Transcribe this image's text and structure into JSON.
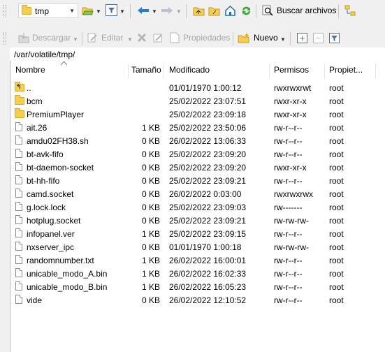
{
  "toolbar_top": {
    "location_value": "tmp",
    "search_label": "Buscar archivos"
  },
  "toolbar_actions": {
    "download_label": "Descargar",
    "edit_label": "Editar",
    "properties_label": "Propiedades",
    "new_label": "Nuevo"
  },
  "path": "/var/volatile/tmp/",
  "columns": {
    "name": "Nombre",
    "size": "Tamaño",
    "modified": "Modificado",
    "permissions": "Permisos",
    "owner": "Propiet..."
  },
  "files": [
    {
      "name": "..",
      "size": "",
      "modified": "01/01/1970 1:00:12",
      "permissions": "rwxrwxrwt",
      "owner": "root",
      "type": "parent"
    },
    {
      "name": "bcm",
      "size": "",
      "modified": "25/02/2022 23:07:51",
      "permissions": "rwxr-xr-x",
      "owner": "root",
      "type": "folder"
    },
    {
      "name": "PremiumPlayer",
      "size": "",
      "modified": "25/02/2022 23:09:18",
      "permissions": "rwxr-xr-x",
      "owner": "root",
      "type": "folder"
    },
    {
      "name": "ait.26",
      "size": "1 KB",
      "modified": "25/02/2022 23:50:06",
      "permissions": "rw-r--r--",
      "owner": "root",
      "type": "file"
    },
    {
      "name": "amdu02FH38.sh",
      "size": "0 KB",
      "modified": "26/02/2022 13:06:33",
      "permissions": "rw-r--r--",
      "owner": "root",
      "type": "file"
    },
    {
      "name": "bt-avk-fifo",
      "size": "0 KB",
      "modified": "25/02/2022 23:09:20",
      "permissions": "rw-r--r--",
      "owner": "root",
      "type": "file"
    },
    {
      "name": "bt-daemon-socket",
      "size": "0 KB",
      "modified": "25/02/2022 23:09:20",
      "permissions": "rwxr-xr-x",
      "owner": "root",
      "type": "file"
    },
    {
      "name": "bt-hh-fifo",
      "size": "0 KB",
      "modified": "25/02/2022 23:09:21",
      "permissions": "rw-r--r--",
      "owner": "root",
      "type": "file"
    },
    {
      "name": "camd.socket",
      "size": "0 KB",
      "modified": "26/02/2022 0:03:00",
      "permissions": "rwxrwxrwx",
      "owner": "root",
      "type": "file"
    },
    {
      "name": "g.lock.lock",
      "size": "0 KB",
      "modified": "25/02/2022 23:09:03",
      "permissions": "rw-------",
      "owner": "root",
      "type": "file"
    },
    {
      "name": "hotplug.socket",
      "size": "0 KB",
      "modified": "25/02/2022 23:09:21",
      "permissions": "rw-rw-rw-",
      "owner": "root",
      "type": "file"
    },
    {
      "name": "infopanel.ver",
      "size": "1 KB",
      "modified": "25/02/2022 23:09:15",
      "permissions": "rw-r--r--",
      "owner": "root",
      "type": "file"
    },
    {
      "name": "nxserver_ipc",
      "size": "0 KB",
      "modified": "01/01/1970 1:00:18",
      "permissions": "rw-rw-rw-",
      "owner": "root",
      "type": "file"
    },
    {
      "name": "randomnumber.txt",
      "size": "1 KB",
      "modified": "26/02/2022 16:00:01",
      "permissions": "rw-r--r--",
      "owner": "root",
      "type": "file"
    },
    {
      "name": "unicable_modo_A.bin",
      "size": "1 KB",
      "modified": "26/02/2022 16:02:33",
      "permissions": "rw-r--r--",
      "owner": "root",
      "type": "file"
    },
    {
      "name": "unicable_modo_B.bin",
      "size": "1 KB",
      "modified": "26/02/2022 16:05:23",
      "permissions": "rw-r--r--",
      "owner": "root",
      "type": "file"
    },
    {
      "name": "vide",
      "size": "0 KB",
      "modified": "26/02/2022 12:10:52",
      "permissions": "rw-r--r--",
      "owner": "root",
      "type": "file"
    }
  ]
}
